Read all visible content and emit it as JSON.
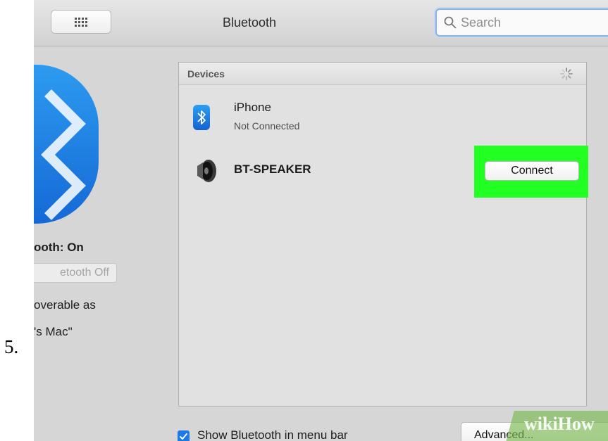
{
  "step_number": "5.",
  "window": {
    "title": "Bluetooth",
    "search": {
      "placeholder": "Search"
    }
  },
  "left_panel": {
    "status": "ooth: On",
    "toggle_button_label": "etooth Off",
    "discoverable_text": "overable as",
    "mac_name": "'s Mac\""
  },
  "devices": {
    "header": "Devices",
    "items": [
      {
        "name": "iPhone",
        "status": "Not Connected",
        "icon": "bluetooth-icon"
      },
      {
        "name": "BT-SPEAKER",
        "status": "",
        "icon": "speaker-icon",
        "action": "Connect",
        "highlight_color": "#22ff22"
      }
    ]
  },
  "bottom_bar": {
    "show_in_menu_bar_label": "Show Bluetooth in menu bar",
    "show_in_menu_bar_checked": true,
    "advanced_label": "Advanced..."
  },
  "watermark": "wikiHow",
  "colors": {
    "accent": "#1c79e6",
    "highlight": "#22ff22",
    "bluetooth_blue": "#1a7ee4"
  }
}
